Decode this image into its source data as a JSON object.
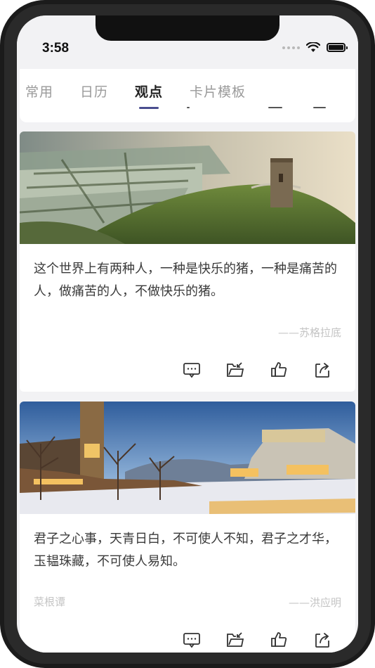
{
  "status_bar": {
    "time": "3:58"
  },
  "tabs": [
    {
      "label": "常用",
      "active": false
    },
    {
      "label": "日历",
      "active": false
    },
    {
      "label": "观点",
      "active": true
    },
    {
      "label": "卡片模板",
      "active": false
    }
  ],
  "cards": [
    {
      "image": "green-hill-tower-landscape",
      "quote": "这个世界上有两种人，一种是快乐的猪，一种是痛苦的人，做痛苦的人，不做快乐的猪。",
      "author": "——苏格拉底",
      "source": "",
      "actions": [
        "comment-icon",
        "folder-icon",
        "like-icon",
        "share-icon"
      ]
    },
    {
      "image": "winter-city-castle-night",
      "quote": "君子之心事，天青日白，不可使人不知，君子之才华，玉韫珠藏，不可使人易知。",
      "author": "——洪应明",
      "source": "菜根谭",
      "actions": [
        "comment-icon",
        "folder-icon",
        "like-icon",
        "share-icon"
      ]
    }
  ],
  "colors": {
    "accent": "#4a4e8f",
    "background": "#f2f2f4",
    "muted_text": "#c4c4c4"
  }
}
